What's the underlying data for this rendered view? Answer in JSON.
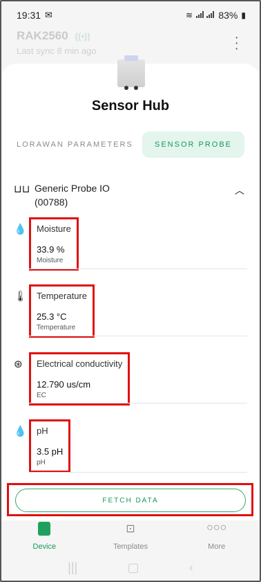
{
  "status_bar": {
    "time": "19:31",
    "battery": "83%",
    "network": "Vo) LTE1 ... Vo) LTE2"
  },
  "app_bar": {
    "device_name": "RAK2560",
    "last_sync": "Last sync 8 min ago"
  },
  "sheet": {
    "title": "Sensor Hub",
    "tabs": [
      {
        "label": "LORAWAN PARAMETERS",
        "active": false
      },
      {
        "label": "SENSOR PROBE",
        "active": true
      }
    ],
    "probe": {
      "name": "Generic Probe IO",
      "id": "(00788)"
    },
    "readings": [
      {
        "name": "Moisture",
        "value": "33.9 %",
        "sub": "Moisture",
        "icon": "drop-icon"
      },
      {
        "name": "Temperature",
        "value": "25.3 °C",
        "sub": "Temperature",
        "icon": "thermometer-icon"
      },
      {
        "name": "Electrical conductivity",
        "value": "12.790 us/cm",
        "sub": "EC",
        "icon": "conductivity-icon"
      },
      {
        "name": "pH",
        "value": "3.5 pH",
        "sub": "pH",
        "icon": "ph-drop-icon"
      }
    ],
    "fetch_label": "FETCH DATA"
  },
  "bottom_nav": [
    {
      "label": "Device",
      "active": true,
      "icon": "device-icon"
    },
    {
      "label": "Templates",
      "active": false,
      "icon": "templates-icon"
    },
    {
      "label": "More",
      "active": false,
      "icon": "more-icon"
    }
  ],
  "colors": {
    "accent": "#179a5a",
    "highlight": "#e01010"
  }
}
